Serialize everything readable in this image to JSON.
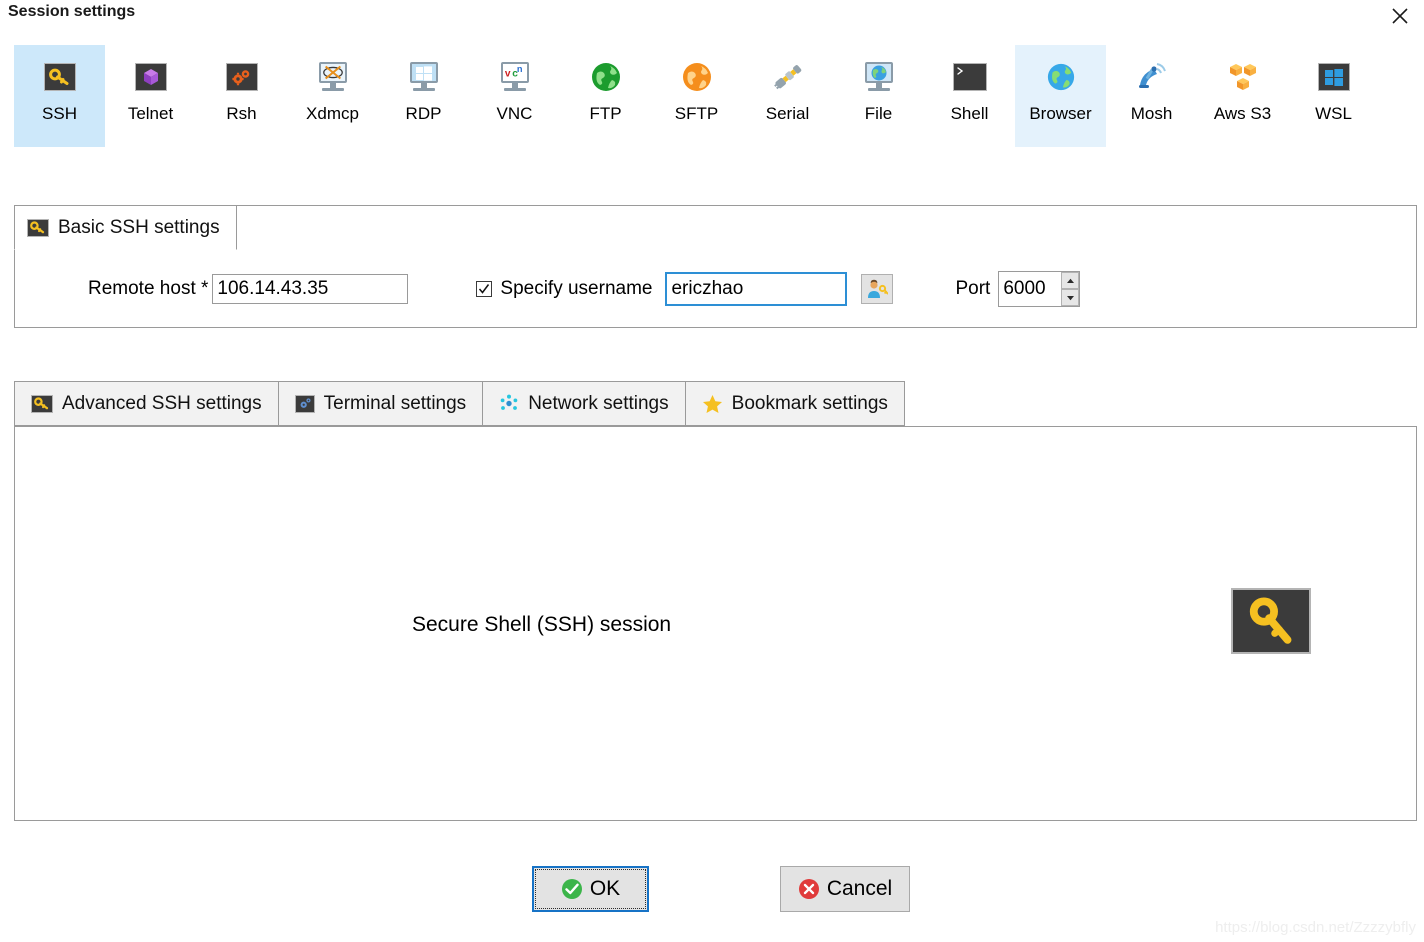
{
  "window": {
    "title": "Session settings",
    "close_icon": "close-icon"
  },
  "session_types": [
    {
      "label": "SSH",
      "icon": "ssh-key-icon",
      "state": "selected"
    },
    {
      "label": "Telnet",
      "icon": "telnet-cube-icon",
      "state": "normal"
    },
    {
      "label": "Rsh",
      "icon": "rsh-gears-icon",
      "state": "normal"
    },
    {
      "label": "Xdmcp",
      "icon": "xdmcp-xmonitor-icon",
      "state": "normal"
    },
    {
      "label": "RDP",
      "icon": "rdp-windows-icon",
      "state": "normal"
    },
    {
      "label": "VNC",
      "icon": "vnc-monitor-icon",
      "state": "normal"
    },
    {
      "label": "FTP",
      "icon": "ftp-green-globe-icon",
      "state": "normal"
    },
    {
      "label": "SFTP",
      "icon": "sftp-orange-globe-icon",
      "state": "normal"
    },
    {
      "label": "Serial",
      "icon": "serial-plug-icon",
      "state": "normal"
    },
    {
      "label": "File",
      "icon": "file-globe-monitor-icon",
      "state": "normal"
    },
    {
      "label": "Shell",
      "icon": "shell-prompt-icon",
      "state": "normal"
    },
    {
      "label": "Browser",
      "icon": "browser-globe-icon",
      "state": "hovered"
    },
    {
      "label": "Mosh",
      "icon": "mosh-satellite-icon",
      "state": "normal"
    },
    {
      "label": "Aws S3",
      "icon": "aws-s3-boxes-icon",
      "state": "normal"
    },
    {
      "label": "WSL",
      "icon": "wsl-windows-icon",
      "state": "normal"
    }
  ],
  "basic_panel": {
    "tab_label": "Basic SSH settings",
    "tab_icon": "ssh-key-icon",
    "remote_host": {
      "label": "Remote host *",
      "value": "106.14.43.35",
      "placeholder": ""
    },
    "specify_username": {
      "label": "Specify username",
      "checked": true,
      "value": "ericzhao",
      "placeholder": "",
      "browse_icon": "user-key-icon"
    },
    "port": {
      "label": "Port",
      "value": "6000",
      "up_icon": "spinner-up-icon",
      "down_icon": "spinner-down-icon"
    }
  },
  "settings_tabs": [
    {
      "label": "Advanced SSH settings",
      "icon": "ssh-key-icon"
    },
    {
      "label": "Terminal settings",
      "icon": "terminal-gear-icon"
    },
    {
      "label": "Network settings",
      "icon": "network-dots-icon"
    },
    {
      "label": "Bookmark settings",
      "icon": "star-icon"
    }
  ],
  "content": {
    "description": "Secure Shell (SSH) session",
    "big_icon": "ssh-key-icon"
  },
  "buttons": {
    "ok": {
      "label": "OK",
      "icon": "check-circle-icon"
    },
    "cancel": {
      "label": "Cancel",
      "icon": "x-circle-icon"
    }
  },
  "watermark": "https://blog.csdn.net/Zzzzybfly",
  "colors": {
    "selected_tab_bg": "#cde8fa",
    "hovered_tab_bg": "#e4f2fc",
    "focus_border": "#2d8fd5",
    "ok_accent": "#3cb54a",
    "cancel_accent": "#e03b3b",
    "panel_border": "#9a9a9a",
    "tab_bg": "#f2f2f2",
    "key_yellow": "#f5c021"
  }
}
